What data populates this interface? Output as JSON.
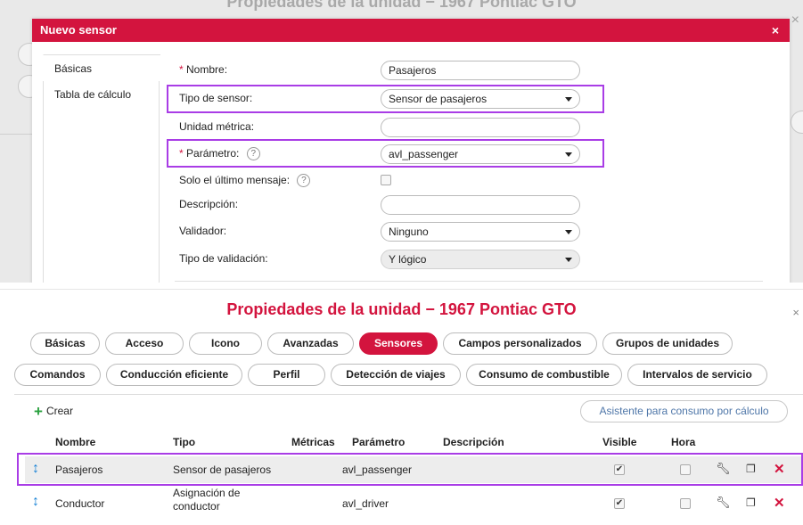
{
  "background": {
    "title": "Propiedades de la unidad − 1967 Pontiac GTO",
    "close": "×"
  },
  "dialog": {
    "title": "Nuevo sensor",
    "close": "×",
    "sidebar": {
      "items": [
        {
          "label": "Básicas"
        },
        {
          "label": "Tabla de cálculo"
        }
      ]
    },
    "fields": {
      "name": {
        "required_mark": "*",
        "label": "Nombre:",
        "value": "Pasajeros"
      },
      "sensor_type": {
        "label": "Tipo de sensor:",
        "value": "Sensor de pasajeros"
      },
      "metric_unit": {
        "label": "Unidad métrica:",
        "value": ""
      },
      "parameter": {
        "required_mark": "*",
        "label": "Parámetro:",
        "help": "?",
        "value": "avl_passenger"
      },
      "last_message_only": {
        "label": "Solo el último mensaje:",
        "help": "?",
        "checked": false
      },
      "description": {
        "label": "Descripción:",
        "value": ""
      },
      "validator": {
        "label": "Validador:",
        "value": "Ninguno"
      },
      "validation_type": {
        "label": "Tipo de validación:",
        "value": "Y lógico"
      }
    }
  },
  "properties": {
    "title": "Propiedades de la unidad − 1967 Pontiac GTO",
    "close": "×",
    "tabs_row1": [
      {
        "label": "Básicas"
      },
      {
        "label": "Acceso"
      },
      {
        "label": "Icono"
      },
      {
        "label": "Avanzadas"
      },
      {
        "label": "Sensores",
        "active": true
      },
      {
        "label": "Campos personalizados"
      },
      {
        "label": "Grupos de unidades"
      }
    ],
    "tabs_row2": [
      {
        "label": "Comandos"
      },
      {
        "label": "Conducción eficiente"
      },
      {
        "label": "Perfil"
      },
      {
        "label": "Detección de viajes"
      },
      {
        "label": "Consumo de combustible"
      },
      {
        "label": "Intervalos de servicio"
      }
    ],
    "create_icon": "+",
    "create_label": "Crear",
    "wizard_label": "Asistente para consumo por cálculo",
    "table": {
      "columns": [
        "Nombre",
        "Tipo",
        "Métricas",
        "Parámetro",
        "Descripción",
        "Visible",
        "Hora"
      ],
      "rows": [
        {
          "name": "Pasajeros",
          "type": "Sensor de pasajeros",
          "metrics": "",
          "parameter": "avl_passenger",
          "description": "",
          "visible": true,
          "time": false
        },
        {
          "name": "Conductor",
          "type": "Asignación de conductor",
          "metrics": "",
          "parameter": "avl_driver",
          "description": "",
          "visible": true,
          "time": false
        }
      ]
    }
  },
  "colors": {
    "accent": "#d3143e",
    "highlight": "#a93de6",
    "link": "#4e76a8",
    "create_plus": "#2aa13f",
    "sort_icon": "#1a83d6"
  },
  "icons": {
    "sort": "sort-arrows-icon",
    "edit": "wrench-icon",
    "copy": "copy-icon",
    "delete": "delete-x-icon"
  }
}
